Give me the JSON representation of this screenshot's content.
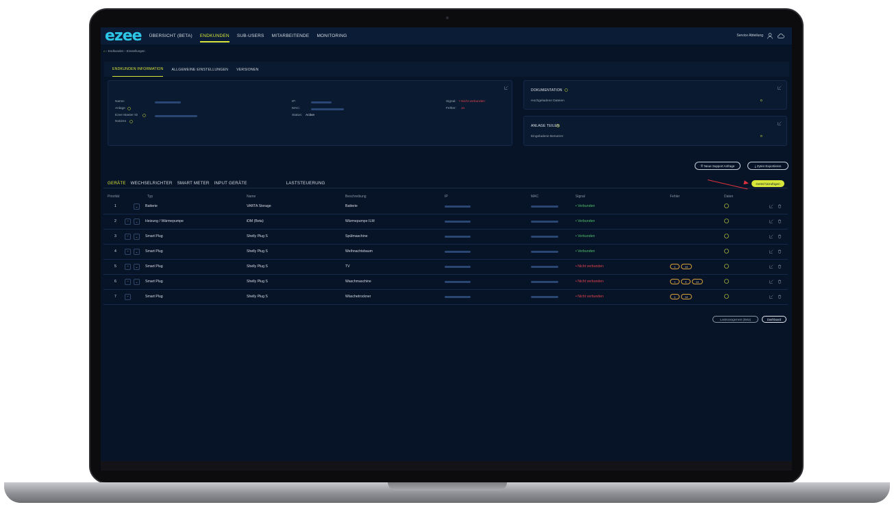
{
  "nav": {
    "logo": "ezee",
    "items": [
      "ÜBERSICHT (BETA)",
      "ENDKUNDEN",
      "SUB-USERS",
      "MITARBEITENDE",
      "MONITORING"
    ],
    "active_index": 1,
    "user": "Service Abteilung"
  },
  "breadcrumb": {
    "path": "Endkunden",
    "sep": "›",
    "current": "Einstellungen"
  },
  "top_tabs": [
    "ENDKUNDEN INFORMATION",
    "ALLGEMEINE EINSTELLUNGEN",
    "VERSIONEN"
  ],
  "info": {
    "name_label": "Name:",
    "anlage_label": "Anlage",
    "master_label": "Ezee Master ID",
    "notizen_label": "Notizen",
    "ip_label": "IP:",
    "mac_label": "MAC:",
    "status_label": "Status:",
    "status_value": "Active",
    "signal_label": "Signal:",
    "signal_value": "• Nicht verbunden",
    "fehler_label": "Fehler:",
    "fehler_value": "Ja"
  },
  "documentation": {
    "title": "DOKUMENTATION",
    "label": "Hochgeladene Dateien",
    "value": "0"
  },
  "share": {
    "title": "ANLAGE TEILEN",
    "label": "Eingeladene Benutzer",
    "value": "0"
  },
  "actions": {
    "support": "Neue Support Anfrage",
    "export": "Zyten Exportieren",
    "add_device": "Gerät hinzufügen"
  },
  "device_tabs": [
    "GERÄTE",
    "WECHSELRICHTER",
    "SMART METER",
    "INPUT GERÄTE",
    "LASTSTEUERUNG"
  ],
  "table": {
    "headers": [
      "Priorität",
      "Typ",
      "Name",
      "Beschreibung",
      "IP",
      "MAC",
      "Signal",
      "Fehler",
      "Daten"
    ],
    "rows": [
      {
        "prio": "1",
        "typ": "Batterie",
        "name": "VARTA Storage",
        "desc": "Batterie",
        "signal": "• Verbunden",
        "ok": true,
        "errors": []
      },
      {
        "prio": "2",
        "typ": "Heizung / Wärmepumpe",
        "name": "iDM (Beta)",
        "desc": "Wärmepumpe ILM",
        "signal": "• Verbunden",
        "ok": true,
        "errors": []
      },
      {
        "prio": "3",
        "typ": "Smart Plug",
        "name": "Shelly Plug S",
        "desc": "Spülmaschine",
        "signal": "• Verbunden",
        "ok": true,
        "errors": []
      },
      {
        "prio": "4",
        "typ": "Smart Plug",
        "name": "Shelly Plug S",
        "desc": "Weihnachtsbaum",
        "signal": "• Verbunden",
        "ok": true,
        "errors": []
      },
      {
        "prio": "5",
        "typ": "Smart Plug",
        "name": "Shelly Plug S",
        "desc": "TV",
        "signal": "• Nicht verbunden",
        "ok": false,
        "errors": [
          "1",
          "10"
        ]
      },
      {
        "prio": "6",
        "typ": "Smart Plug",
        "name": "Shelly Plug S",
        "desc": "Waschmaschine",
        "signal": "• Nicht verbunden",
        "ok": false,
        "errors": [
          "1",
          "3",
          "10"
        ]
      },
      {
        "prio": "7",
        "typ": "Smart Plug",
        "name": "Shelly Plug S",
        "desc": "Wäschetrockner",
        "signal": "• Nicht verbunden",
        "ok": false,
        "errors": [
          "1",
          "10"
        ]
      }
    ]
  },
  "bottom": {
    "lastmanagement": "Lastmanagement (Beta)",
    "dashboard": "Dashboard"
  },
  "colors": {
    "accent": "#d8e63a",
    "bg": "#071428",
    "ok": "#4fbf6a",
    "error": "#e0434c"
  }
}
